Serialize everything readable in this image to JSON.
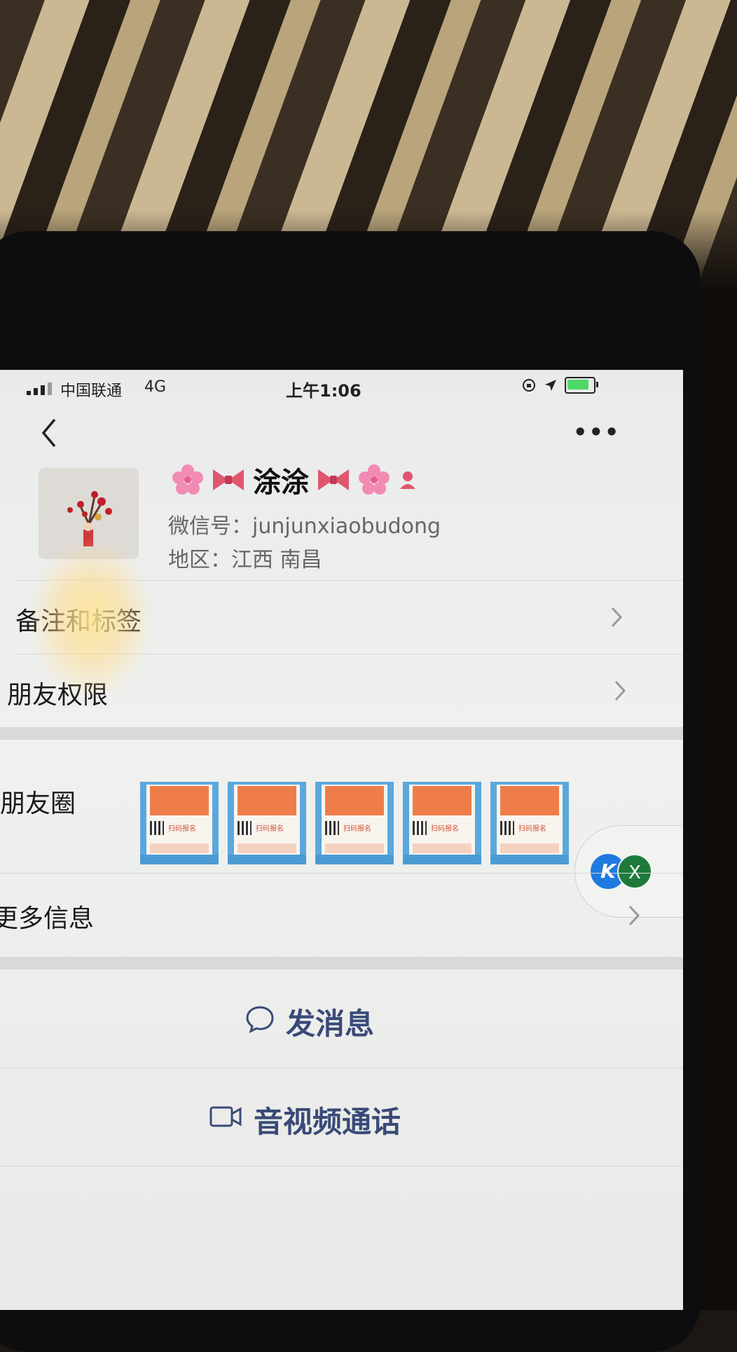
{
  "status_bar": {
    "carrier": "中国联通",
    "network": "4G",
    "time": "上午1:06"
  },
  "profile": {
    "name": "涂涂",
    "wechat_id": "微信号：junjunxiaobudong",
    "region": "地区：江西 南昌"
  },
  "rows": {
    "remark_tags": "备注和标签",
    "friend_permissions": "朋友权限",
    "moments": "朋友圈",
    "more_info": "更多信息"
  },
  "moments_thumbs": [
    {
      "caption": "扫码报名"
    },
    {
      "caption": "扫码报名"
    },
    {
      "caption": "扫码报名"
    },
    {
      "caption": "扫码报名"
    },
    {
      "caption": "扫码报名"
    }
  ],
  "floating": {
    "badge_left": "K",
    "badge_right": "X"
  },
  "actions": {
    "send_message": "发消息",
    "video_call": "音视频通话"
  },
  "colors": {
    "accent_blue": "#3a4a78",
    "battery_green": "#4cd964"
  }
}
